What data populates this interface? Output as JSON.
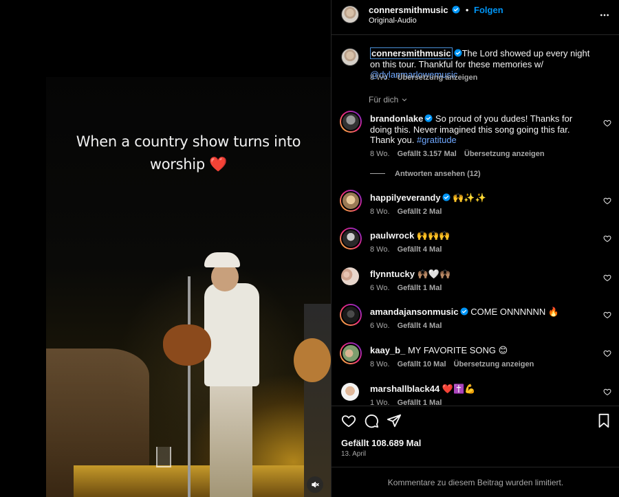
{
  "media": {
    "overlay_line1": "When a country show turns into",
    "overlay_line2": "worship",
    "overlay_emoji": "❤️"
  },
  "header": {
    "username": "connersmithmusic",
    "dot": "•",
    "follow": "Folgen",
    "subtitle": "Original-Audio",
    "more_icon": "more-horizontal-icon"
  },
  "caption": {
    "username": "connersmithmusic",
    "text": "The Lord showed up every night on this tour. Thankful for these memories w/ ",
    "mention": "@dylanmarlowemusic",
    "time": "8 Wo.",
    "translate": "Übersetzung anzeigen"
  },
  "for_you": "Für dich",
  "comments": [
    {
      "username": "brandonlake",
      "verified": true,
      "text": "So proud of you dudes! Thanks for doing this. Never imagined this song going this far. Thank you.",
      "hashtag": "#gratitude",
      "time": "8 Wo.",
      "likes": "Gefällt 3.157 Mal",
      "translate": "Übersetzung anzeigen",
      "replies": "Antworten ansehen (12)"
    },
    {
      "username": "happilyeverandy",
      "verified": true,
      "text": "🙌✨✨",
      "time": "8 Wo.",
      "likes": "Gefällt 2 Mal"
    },
    {
      "username": "paulwrock",
      "verified": false,
      "text": "🙌🙌🙌",
      "time": "8 Wo.",
      "likes": "Gefällt 4 Mal"
    },
    {
      "username": "flynntucky",
      "verified": false,
      "text": "🙌🏽🤍🙌🏽",
      "time": "6 Wo.",
      "likes": "Gefällt 1 Mal"
    },
    {
      "username": "amandajansonmusic",
      "verified": true,
      "text": "COME ONNNNNN 🔥",
      "time": "6 Wo.",
      "likes": "Gefällt 4 Mal"
    },
    {
      "username": "kaay_b_",
      "verified": false,
      "text": "MY FAVORITE SONG 😊",
      "time": "8 Wo.",
      "likes": "Gefällt 10 Mal",
      "translate": "Übersetzung anzeigen"
    },
    {
      "username": "marshallblack44",
      "verified": false,
      "text": "❤️✝️💪",
      "time": "1 Wo.",
      "likes": "Gefällt 1 Mal"
    }
  ],
  "actions": {
    "likes": "Gefällt 108.689 Mal",
    "date": "13. April"
  },
  "footer": {
    "limited": "Kommentare zu diesem Beitrag wurden limitiert."
  },
  "colors": {
    "background": "#000000",
    "verified_blue": "#0095f6",
    "follow_blue": "#0095f6",
    "link_blue": "#6fa8ff",
    "secondary_text": "#a8a8a8"
  }
}
